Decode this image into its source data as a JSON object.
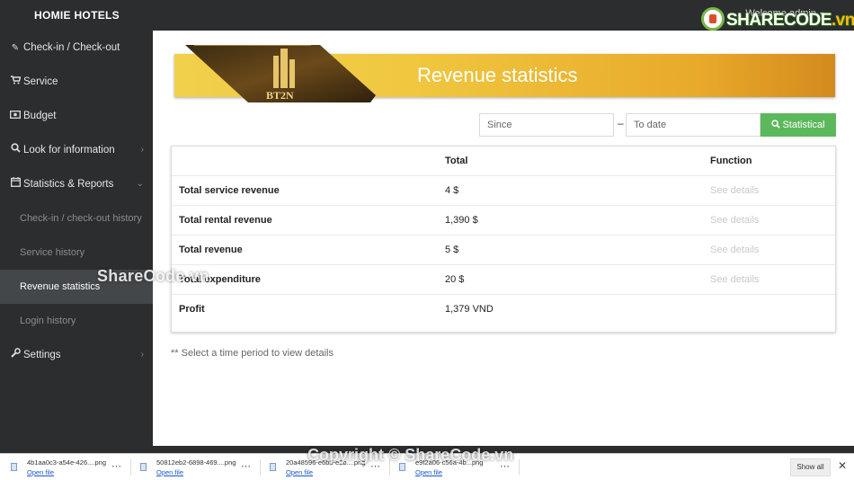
{
  "sidebar": {
    "brand": "HOMIE HOTELS",
    "checkin": "Check-in / Check-out",
    "service": "Service",
    "budget": "Budget",
    "lookup": "Look for information",
    "stats": "Statistics & Reports",
    "sub_checkin": "Check-in / check-out history",
    "sub_service": "Service history",
    "sub_revenue": "Revenue statistics",
    "sub_login": "Login history",
    "settings": "Settings"
  },
  "topbar": {
    "welcome": "Welcome admin",
    "logo_text": "SHARECODE",
    "logo_suffix": ".vn"
  },
  "banner": {
    "title": "Revenue statistics",
    "logo_text": "BT2N"
  },
  "filters": {
    "since_placeholder": "Since",
    "to_placeholder": "To date",
    "separator": "–",
    "button": "Statistical"
  },
  "table": {
    "headers": [
      "",
      "Total",
      "Function"
    ],
    "rows": [
      {
        "label": "Total service revenue",
        "total": "4 $",
        "action": "See details"
      },
      {
        "label": "Total rental revenue",
        "total": "1,390 $",
        "action": "See details"
      },
      {
        "label": "Total revenue",
        "total": "5 $",
        "action": "See details"
      },
      {
        "label": "Total expenditure",
        "total": "20 $",
        "action": "See details"
      },
      {
        "label": "Profit",
        "total": "1,379 VND",
        "action": ""
      }
    ]
  },
  "note": "** Select a time period to view details",
  "watermark": {
    "side": "ShareCode.vn",
    "bottom": "Copyright © ShareCode.vn"
  },
  "downloads": {
    "items": [
      {
        "name": "4b1aa0c3-a54e-426....png",
        "open": "Open file"
      },
      {
        "name": "50812eb2-6898-469....png",
        "open": "Open file"
      },
      {
        "name": "20a48596-e6b5-e2b....png",
        "open": "Open file"
      },
      {
        "name": "e9f2a06-c56a-4b...png",
        "open": "Open file"
      }
    ],
    "show_all": "Show all",
    "close": "✕"
  },
  "colors": {
    "sidebar_bg": "#2b2d2f",
    "active_bg": "#44474a",
    "accent_green": "#5cb85c",
    "banner_gold": "#f0c840"
  }
}
